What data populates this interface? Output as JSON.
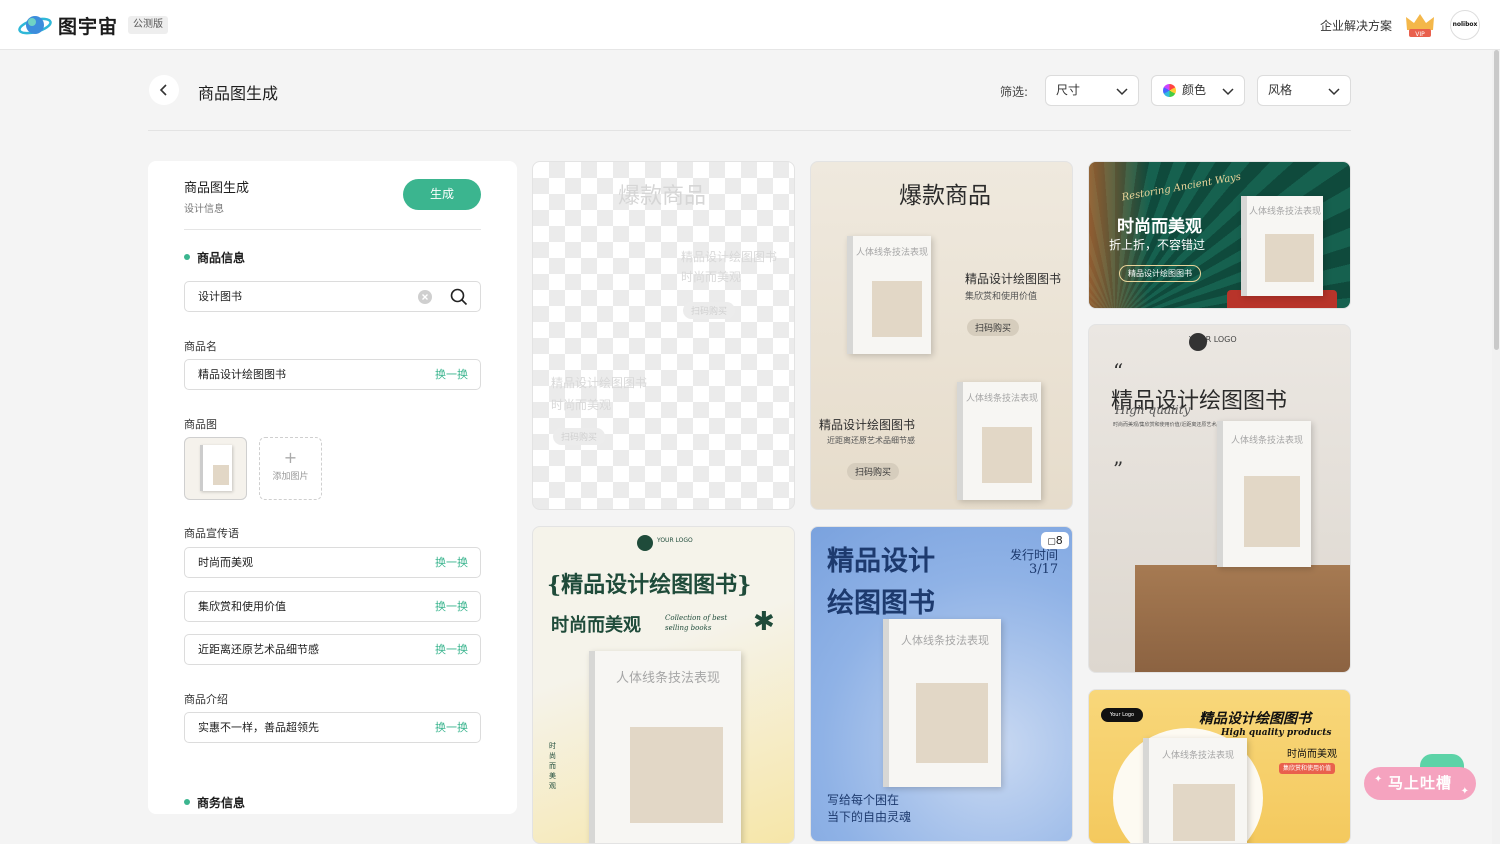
{
  "header": {
    "brand": "图宇宙",
    "beta_badge": "公测版",
    "enterprise_link": "企业解决方案",
    "vip_badge": "VIP",
    "avatar_text": "nolibox"
  },
  "title_row": {
    "page_title": "商品图生成",
    "filter_label": "筛选:",
    "filters": [
      {
        "label": "尺寸"
      },
      {
        "label": "颜色"
      },
      {
        "label": "风格"
      }
    ]
  },
  "panel": {
    "title": "商品图生成",
    "subtitle": "设计信息",
    "generate_button": "生成",
    "section_product": "商品信息",
    "search_value": "设计图书",
    "name_label": "商品名",
    "name_value": "精品设计绘图图书",
    "swap_label": "换一换",
    "image_label": "商品图",
    "add_image": "添加图片",
    "slogan_label": "商品宣传语",
    "slogans": [
      "时尚而美观",
      "集欣赏和使用价值",
      "近距离还原艺术品细节感"
    ],
    "intro_label": "商品介绍",
    "intro_value": "实惠不一样，善品超领先",
    "section_business": "商务信息"
  },
  "cards": {
    "c1": {
      "title": "爆款商品",
      "line1": "精品设计绘图图书",
      "line2": "时尚而美观",
      "tag": "扫码购买",
      "line3": "精品设计绘图图书",
      "line4": "时尚而美观",
      "tag2": "扫码购买"
    },
    "c2": {
      "title": "爆款商品",
      "book_title": "人体线条技法表现",
      "line1": "精品设计绘图图书",
      "line2": "集欣赏和使用价值",
      "tag": "扫码购买",
      "line3": "精品设计绘图图书",
      "line4": "近距离还原艺术品细节感",
      "tag2": "扫码购买"
    },
    "c3": {
      "script": "Restoring Ancient Ways",
      "title": "时尚而美观",
      "sub": "折上折，不容错过",
      "tag": "精品设计绘图图书",
      "book_title": "人体线条技法表现"
    },
    "c4": {
      "logo": "YOUR LOGO",
      "quote_open": "“",
      "title": "精品设计绘图图书",
      "en": "High quality",
      "desc": "时尚而美观/集欣赏和使用价值/近距离还原艺术品细节感",
      "quote_close": "”",
      "book_title": "人体线条技法表现"
    },
    "c5": {
      "logo": "YOUR LOGO",
      "title": "{精品设计绘图图书}",
      "sub": "时尚而美观",
      "en": "Collection of best selling books",
      "book_title": "人体线条技法表现",
      "side": "时尚而美观"
    },
    "c6": {
      "title1": "精品设计",
      "title2": "绘图图书",
      "badge": "8",
      "date_label": "发行时间",
      "date": "3/17",
      "book_title": "人体线条技法表现",
      "bottom1": "写给每个困在",
      "bottom2": "当下的自由灵魂"
    },
    "c7": {
      "logo": "Your Logo",
      "title": "精品设计绘图图书",
      "en": "High quality products",
      "sub": "时尚而美观",
      "tag": "集欣赏和使用价值",
      "book_title": "人体线条技法表现"
    }
  },
  "feedback": {
    "label": "马上吐槽"
  },
  "colors": {
    "accent": "#3bb58f",
    "feedback": "#f5a3bf"
  }
}
